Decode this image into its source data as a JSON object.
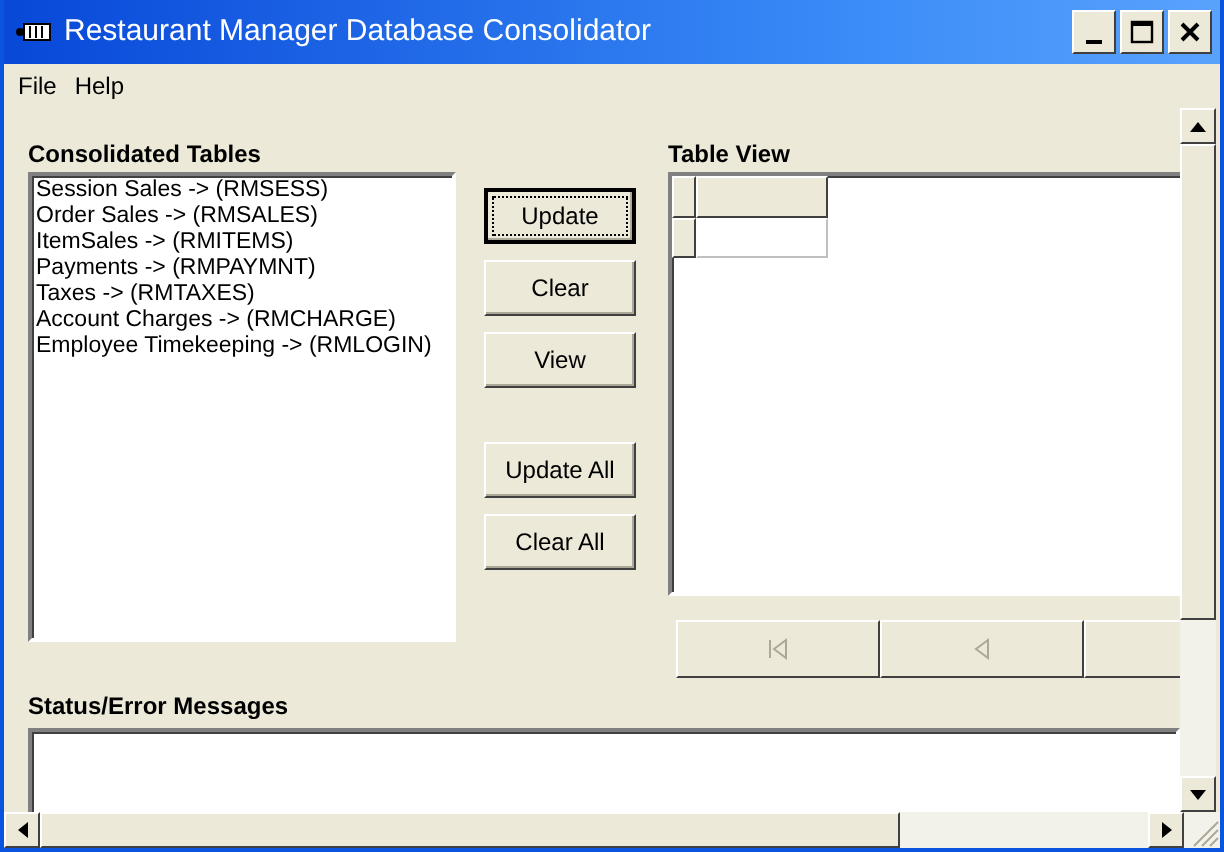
{
  "window": {
    "title": "Restaurant Manager Database Consolidator"
  },
  "menu": [
    "File",
    "Help"
  ],
  "consolidated_tables": {
    "label": "Consolidated Tables",
    "items": [
      "Session Sales -> (RMSESS)",
      "Order Sales -> (RMSALES)",
      "ItemSales -> (RMITEMS)",
      "Payments -> (RMPAYMNT)",
      "Taxes -> (RMTAXES)",
      "Account Charges -> (RMCHARGE)",
      "Employee Timekeeping -> (RMLOGIN)"
    ]
  },
  "buttons": [
    {
      "label": "Update",
      "focused": true
    },
    {
      "label": "Clear",
      "focused": false
    },
    {
      "label": "View",
      "focused": false
    },
    {
      "label": "Update All",
      "focused": false
    },
    {
      "label": "Clear All",
      "focused": false
    }
  ],
  "table_view": {
    "label": "Table View",
    "nav_buttons": [
      {
        "kind": "first",
        "disabled": true
      },
      {
        "kind": "previous",
        "disabled": true
      },
      {
        "kind": "blank",
        "disabled": true
      }
    ]
  },
  "status": {
    "label": "Status/Error Messages"
  }
}
